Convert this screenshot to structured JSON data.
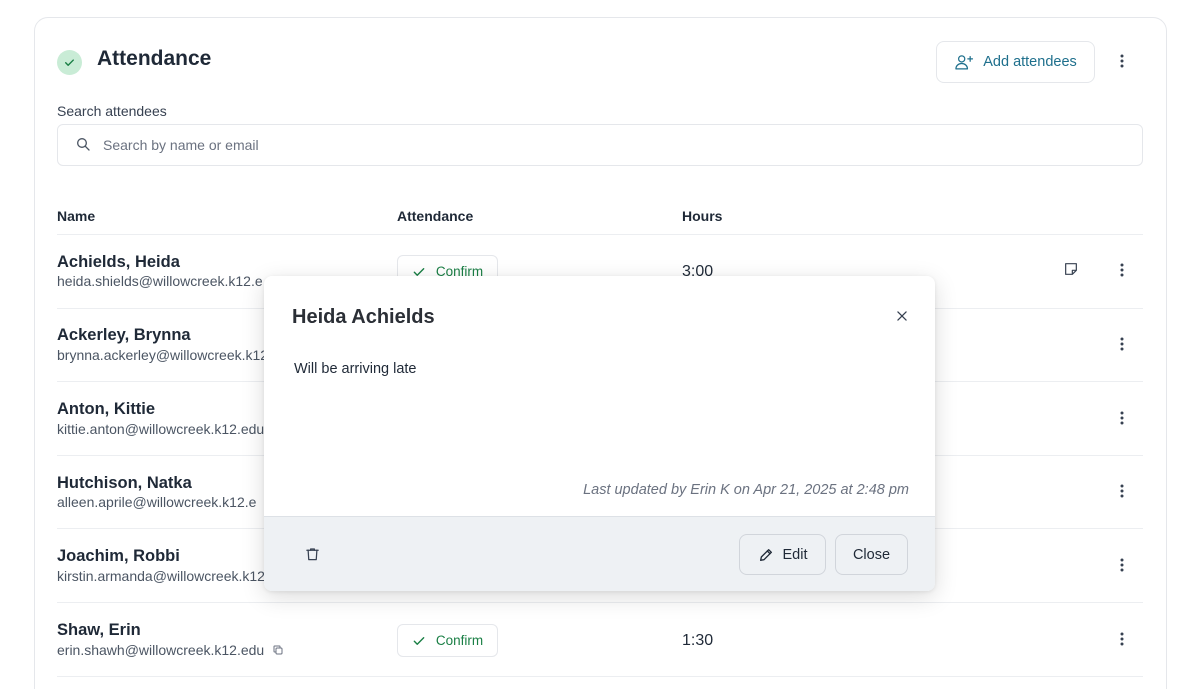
{
  "header": {
    "title": "Attendance",
    "add_button_label": "Add attendees"
  },
  "search": {
    "label": "Search attendees",
    "placeholder": "Search by name or email",
    "value": ""
  },
  "table": {
    "columns": [
      "Name",
      "Attendance",
      "Hours"
    ],
    "rows": [
      {
        "name": "Achields, Heida",
        "email": "heida.shields@willowcreek.k12.e",
        "attendance": "Confirm",
        "hours": "3:00",
        "has_note": true
      },
      {
        "name": "Ackerley, Brynna",
        "email": "brynna.ackerley@willowcreek.k12"
      },
      {
        "name": "Anton, Kittie",
        "email": "kittie.anton@willowcreek.k12.edu"
      },
      {
        "name": "Hutchison, Natka",
        "email": "alleen.aprile@willowcreek.k12.e"
      },
      {
        "name": "Joachim, Robbi",
        "email": "kirstin.armanda@willowcreek.k12"
      },
      {
        "name": "Shaw, Erin",
        "email": "erin.shawh@willowcreek.k12.edu",
        "attendance": "Confirm",
        "hours": "1:30"
      }
    ]
  },
  "modal": {
    "title": "Heida Achields",
    "note": "Will be arriving late",
    "meta": "Last updated by Erin K on Apr 21, 2025 at 2:48 pm",
    "edit_label": "Edit",
    "close_label": "Close"
  },
  "colors": {
    "accent": "#1e6f8c",
    "confirm_green": "#1a7f45",
    "badge_bg": "#c9ecd6",
    "footer_bg": "#eef1f4"
  },
  "icons": [
    "check-circle-icon",
    "user-plus-icon",
    "more-vertical-icon",
    "search-icon",
    "check-icon",
    "note-icon",
    "copy-icon",
    "close-icon",
    "trash-icon",
    "pencil-icon"
  ]
}
